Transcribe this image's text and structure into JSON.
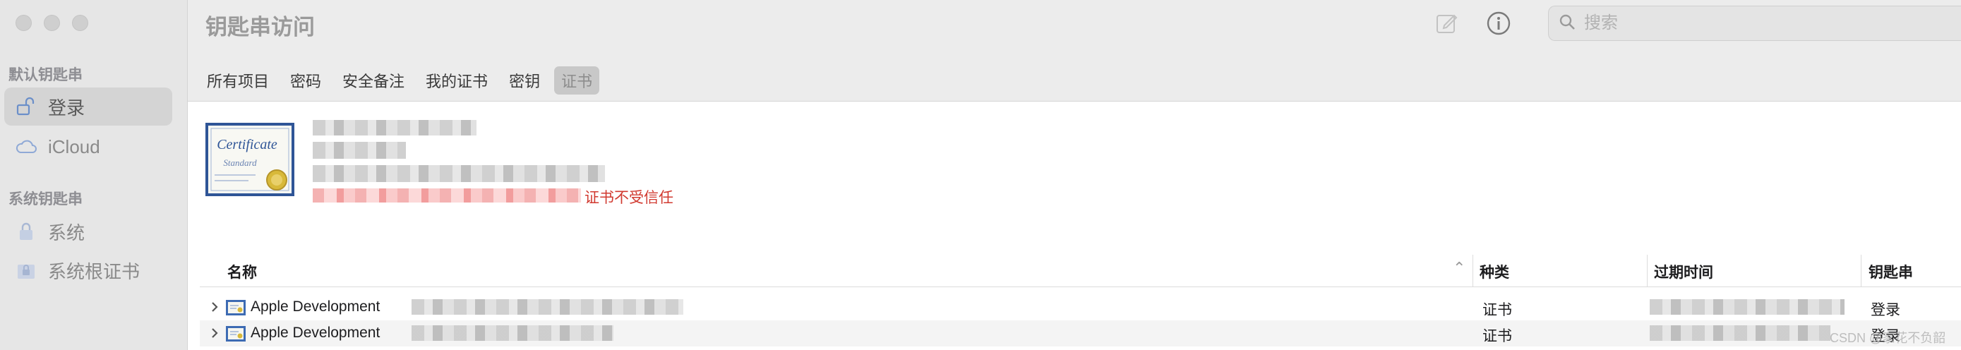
{
  "app": {
    "title": "钥匙串访问"
  },
  "sidebar": {
    "default_keychains_title": "默认钥匙串",
    "system_keychains_title": "系统钥匙串",
    "items": [
      {
        "label": "登录",
        "icon": "unlocked-padlock-icon",
        "selected": true
      },
      {
        "label": "iCloud",
        "icon": "cloud-icon",
        "selected": false
      },
      {
        "label": "系统",
        "icon": "lock-icon",
        "selected": false
      },
      {
        "label": "系统根证书",
        "icon": "cabinet-lock-icon",
        "selected": false
      }
    ]
  },
  "toolbar": {
    "compose_icon": "compose-icon",
    "info_icon": "info-icon",
    "search": {
      "placeholder": "搜索",
      "value": "",
      "icon": "magnifier-icon"
    }
  },
  "tabs": [
    {
      "label": "所有项目",
      "active": false
    },
    {
      "label": "密码",
      "active": false
    },
    {
      "label": "安全备注",
      "active": false
    },
    {
      "label": "我的证书",
      "active": false
    },
    {
      "label": "密钥",
      "active": false
    },
    {
      "label": "证书",
      "active": true
    }
  ],
  "detail": {
    "image_text": "Certificate",
    "image_subtext": "Standard",
    "status_text": "证书不受信任",
    "status_color": "#d13a30"
  },
  "table": {
    "columns": [
      "名称",
      "种类",
      "过期时间",
      "钥匙串"
    ],
    "sort_indicator": "⌃",
    "rows": [
      {
        "name": "Apple Development",
        "kind": "证书",
        "expires": "",
        "keychain": "登录"
      },
      {
        "name": "Apple Development",
        "kind": "证书",
        "expires": "",
        "keychain": "登录"
      }
    ]
  },
  "watermark": "CSDN @家花不负韶"
}
